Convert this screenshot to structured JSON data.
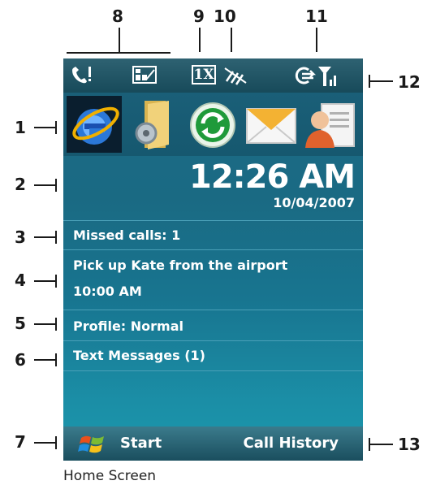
{
  "callouts": {
    "c1": "1",
    "c2": "2",
    "c3": "3",
    "c4": "4",
    "c5": "5",
    "c6": "6",
    "c7": "7",
    "c8": "8",
    "c9": "9",
    "c10": "10",
    "c11": "11",
    "c12": "12",
    "c13": "13"
  },
  "status_bar": {
    "signal_text": "1X",
    "icons": [
      "phone-voicemail-icon",
      "battery-sim-icon",
      "1x-network-icon",
      "no-data-icon",
      "data-connection-icon",
      "signal-strength-icon"
    ]
  },
  "launcher": {
    "apps": [
      "internet-explorer-icon",
      "settings-folder-icon",
      "sync-icon",
      "messaging-icon",
      "contacts-icon"
    ]
  },
  "clock": {
    "time": "12:26 AM",
    "date": "10/04/2007"
  },
  "today": {
    "missed_calls": "Missed calls: 1",
    "appointment_title": "Pick up Kate from the airport",
    "appointment_time": "10:00 AM",
    "profile": "Profile: Normal",
    "text_messages": "Text Messages (1)"
  },
  "softkeys": {
    "left": "Start",
    "right": "Call History"
  },
  "caption": "Home Screen",
  "colors": {
    "screen_top": "#1e6b88",
    "screen_bottom": "#1b98ad",
    "status_bar": "#174a5a",
    "selected_app_bg": "#0a1e2e",
    "text": "#ffffff"
  }
}
